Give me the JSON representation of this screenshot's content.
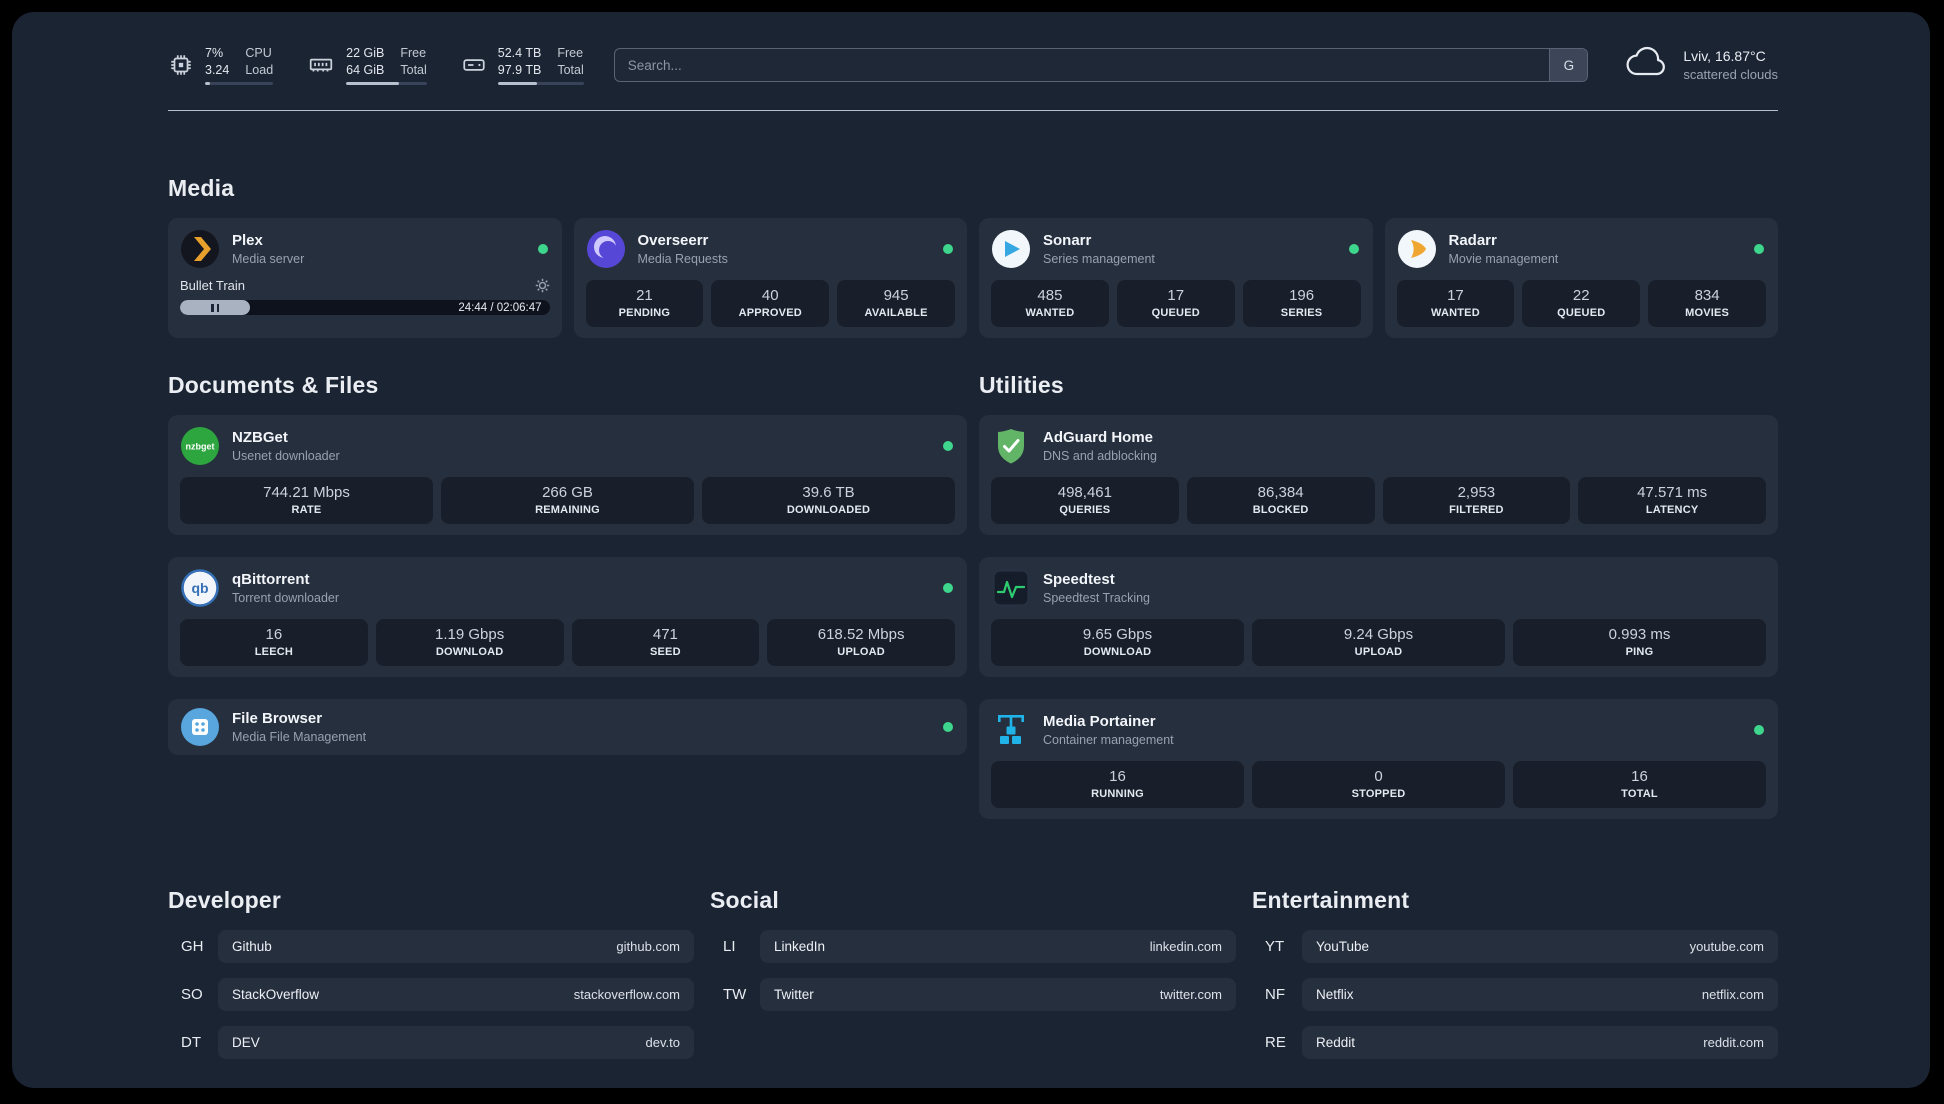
{
  "topbar": {
    "resources": [
      {
        "name": "cpu",
        "value_top": "7%",
        "value_bottom": "3.24",
        "label_top": "CPU",
        "label_bottom": "Load",
        "percent": 7
      },
      {
        "name": "memory",
        "value_top": "22 GiB",
        "value_bottom": "64 GiB",
        "label_top": "Free",
        "label_bottom": "Total",
        "percent": 66
      },
      {
        "name": "disk",
        "value_top": "52.4 TB",
        "value_bottom": "97.9 TB",
        "label_top": "Free",
        "label_bottom": "Total",
        "percent": 46
      }
    ],
    "search": {
      "placeholder": "Search...",
      "button_label": "G"
    },
    "weather": {
      "location": "Lviv, 16.87°C",
      "condition": "scattered clouds"
    }
  },
  "sections": {
    "media": {
      "title": "Media",
      "plex": {
        "name": "Plex",
        "subtitle": "Media server",
        "now_playing": "Bullet Train",
        "time": "24:44 / 02:06:47",
        "progress_percent": 19
      },
      "overseerr": {
        "name": "Overseerr",
        "subtitle": "Media Requests",
        "stats": [
          {
            "value": "21",
            "label": "PENDING"
          },
          {
            "value": "40",
            "label": "APPROVED"
          },
          {
            "value": "945",
            "label": "AVAILABLE"
          }
        ]
      },
      "sonarr": {
        "name": "Sonarr",
        "subtitle": "Series management",
        "stats": [
          {
            "value": "485",
            "label": "WANTED"
          },
          {
            "value": "17",
            "label": "QUEUED"
          },
          {
            "value": "196",
            "label": "SERIES"
          }
        ]
      },
      "radarr": {
        "name": "Radarr",
        "subtitle": "Movie management",
        "stats": [
          {
            "value": "17",
            "label": "WANTED"
          },
          {
            "value": "22",
            "label": "QUEUED"
          },
          {
            "value": "834",
            "label": "MOVIES"
          }
        ]
      }
    },
    "documents": {
      "title": "Documents & Files",
      "nzbget": {
        "name": "NZBGet",
        "subtitle": "Usenet downloader",
        "stats": [
          {
            "value": "744.21 Mbps",
            "label": "RATE"
          },
          {
            "value": "266 GB",
            "label": "REMAINING"
          },
          {
            "value": "39.6 TB",
            "label": "DOWNLOADED"
          }
        ]
      },
      "qbittorrent": {
        "name": "qBittorrent",
        "subtitle": "Torrent downloader",
        "stats": [
          {
            "value": "16",
            "label": "LEECH"
          },
          {
            "value": "1.19 Gbps",
            "label": "DOWNLOAD"
          },
          {
            "value": "471",
            "label": "SEED"
          },
          {
            "value": "618.52 Mbps",
            "label": "UPLOAD"
          }
        ]
      },
      "filebrowser": {
        "name": "File Browser",
        "subtitle": "Media File Management"
      }
    },
    "utilities": {
      "title": "Utilities",
      "adguard": {
        "name": "AdGuard Home",
        "subtitle": "DNS and adblocking",
        "stats": [
          {
            "value": "498,461",
            "label": "QUERIES"
          },
          {
            "value": "86,384",
            "label": "BLOCKED"
          },
          {
            "value": "2,953",
            "label": "FILTERED"
          },
          {
            "value": "47.571 ms",
            "label": "LATENCY"
          }
        ]
      },
      "speedtest": {
        "name": "Speedtest",
        "subtitle": "Speedtest Tracking",
        "stats": [
          {
            "value": "9.65 Gbps",
            "label": "DOWNLOAD"
          },
          {
            "value": "9.24 Gbps",
            "label": "UPLOAD"
          },
          {
            "value": "0.993 ms",
            "label": "PING"
          }
        ]
      },
      "portainer": {
        "name": "Media Portainer",
        "subtitle": "Container management",
        "stats": [
          {
            "value": "16",
            "label": "RUNNING"
          },
          {
            "value": "0",
            "label": "STOPPED"
          },
          {
            "value": "16",
            "label": "TOTAL"
          }
        ]
      }
    },
    "developer": {
      "title": "Developer",
      "links": [
        {
          "abbr": "GH",
          "name": "Github",
          "url": "github.com"
        },
        {
          "abbr": "SO",
          "name": "StackOverflow",
          "url": "stackoverflow.com"
        },
        {
          "abbr": "DT",
          "name": "DEV",
          "url": "dev.to"
        }
      ]
    },
    "social": {
      "title": "Social",
      "links": [
        {
          "abbr": "LI",
          "name": "LinkedIn",
          "url": "linkedin.com"
        },
        {
          "abbr": "TW",
          "name": "Twitter",
          "url": "twitter.com"
        }
      ]
    },
    "entertainment": {
      "title": "Entertainment",
      "links": [
        {
          "abbr": "YT",
          "name": "YouTube",
          "url": "youtube.com"
        },
        {
          "abbr": "NF",
          "name": "Netflix",
          "url": "netflix.com"
        },
        {
          "abbr": "RE",
          "name": "Reddit",
          "url": "reddit.com"
        }
      ]
    }
  },
  "colors": {
    "status_online_green": "#3ed58c",
    "plex_gold": "#e8a02c",
    "adguard_green": "#62b567",
    "portainer_blue": "#1fb3e8"
  }
}
